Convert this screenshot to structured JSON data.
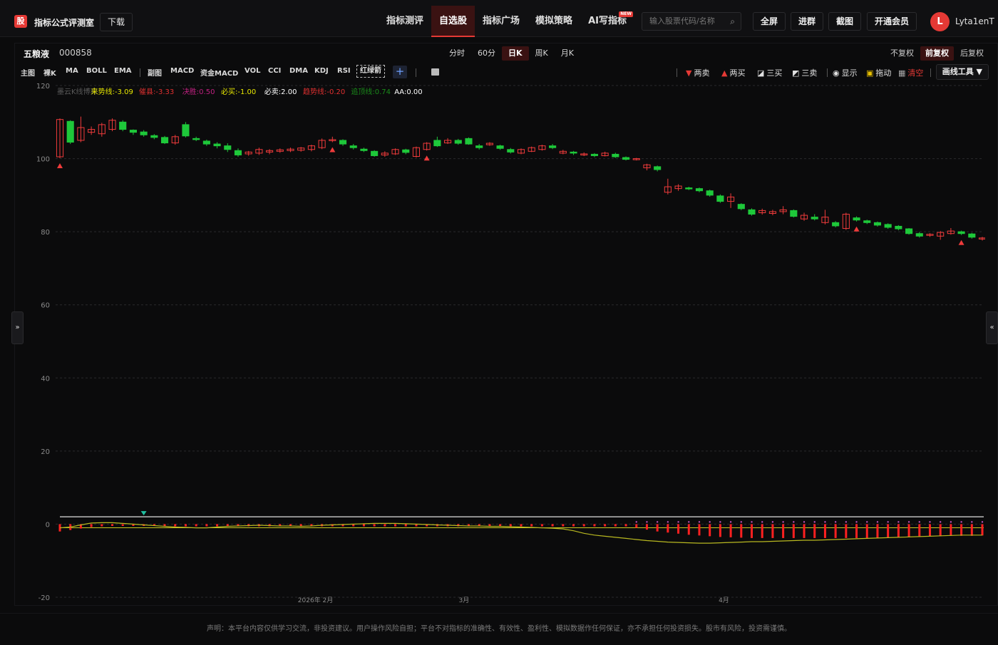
{
  "header": {
    "logo_char": "股",
    "site_title": "指标公式评测室",
    "download": "下载",
    "nav": [
      {
        "label": "指标测评",
        "active": false
      },
      {
        "label": "自选股",
        "active": true
      },
      {
        "label": "指标广场",
        "active": false
      },
      {
        "label": "模拟策略",
        "active": false
      },
      {
        "label": "AI写指标",
        "active": false,
        "badge": "NEW"
      }
    ],
    "search_placeholder": "输入股票代码/名称",
    "buttons": [
      "全屏",
      "进群",
      "截图",
      "开通会员"
    ],
    "avatar_letter": "L",
    "username": "Lyta1enT"
  },
  "stock": {
    "name": "五粮液",
    "code": "000858"
  },
  "periods": [
    {
      "label": "分时",
      "active": false
    },
    {
      "label": "60分",
      "active": false
    },
    {
      "label": "日K",
      "active": true
    },
    {
      "label": "周K",
      "active": false
    },
    {
      "label": "月K",
      "active": false
    }
  ],
  "adjust": [
    {
      "label": "不复权",
      "active": false
    },
    {
      "label": "前复权",
      "active": true
    },
    {
      "label": "后复权",
      "active": false
    }
  ],
  "indicators": {
    "main_label": "主图",
    "main": [
      "裸K",
      "MA",
      "BOLL",
      "EMA"
    ],
    "sub_label": "副图",
    "sub": [
      "MACD",
      "资金MACD",
      "VOL",
      "CCI",
      "DMA",
      "KDJ",
      "RSI"
    ],
    "custom": "红绿箭",
    "add": "+"
  },
  "tools": {
    "two_sell": "两卖",
    "two_buy": "两买",
    "three_buy": "三买",
    "three_sell": "三卖",
    "show": "显示",
    "drag": "拖动",
    "clear": "清空",
    "draw_tool": "画线工具 ▼"
  },
  "legend": [
    {
      "text": "墨云K线博弈",
      "color": "#5a5a5a"
    },
    {
      "text": "来势线:-3.09",
      "color": "#e8e800"
    },
    {
      "text": "催县:-3.33",
      "color": "#e03030"
    },
    {
      "text": "决胜:0.50",
      "color": "#c02080"
    },
    {
      "text": "必买:-1.00",
      "color": "#e8e800"
    },
    {
      "text": "必卖:2.00",
      "color": "#ffffff"
    },
    {
      "text": "趋势线:-0.20",
      "color": "#e03030"
    },
    {
      "text": "追顶线:0.74",
      "color": "#1a8a1a"
    },
    {
      "text": "AA:0.00",
      "color": "#ffffff"
    }
  ],
  "side_left": "»",
  "side_right": "«",
  "footer": "声明：本平台内容仅供学习交流，非投资建议。用户操作风险自担；平台不对指标的准确性、有效性、盈利性、模拟数据作任何保证，亦不承担任何投资损失。股市有风险，投资需谨慎。",
  "chart_data": {
    "type": "candlestick",
    "ylim": [
      -20,
      120
    ],
    "yticks": [
      120,
      100,
      80,
      60,
      40,
      20,
      0,
      -20
    ],
    "xlabels": [
      "2026年 2月",
      "3月",
      "4月"
    ],
    "candles": [
      [
        100.5,
        110.7,
        100.1,
        111.0
      ],
      [
        110.2,
        104.5,
        104.0,
        110.5
      ],
      [
        105.0,
        108.5,
        104.5,
        111.5
      ],
      [
        107.2,
        108.0,
        106.5,
        108.8
      ],
      [
        106.8,
        109.3,
        106.0,
        109.8
      ],
      [
        108.0,
        110.5,
        107.5,
        111.0
      ],
      [
        110.0,
        108.0,
        107.5,
        110.5
      ],
      [
        107.8,
        107.2,
        106.5,
        108.0
      ],
      [
        107.3,
        106.5,
        106.0,
        107.8
      ],
      [
        106.3,
        105.8,
        105.3,
        106.7
      ],
      [
        105.8,
        104.3,
        104.0,
        106.2
      ],
      [
        104.3,
        106.0,
        103.8,
        106.5
      ],
      [
        109.3,
        106.2,
        105.8,
        110.0
      ],
      [
        105.5,
        105.3,
        104.8,
        106.0
      ],
      [
        104.8,
        104.0,
        103.5,
        105.2
      ],
      [
        104.0,
        103.5,
        102.8,
        104.5
      ],
      [
        103.5,
        102.5,
        101.8,
        104.2
      ],
      [
        102.2,
        101.0,
        100.5,
        102.8
      ],
      [
        101.3,
        101.8,
        100.8,
        102.1
      ],
      [
        101.5,
        102.5,
        101.0,
        103.0
      ],
      [
        101.8,
        102.2,
        101.2,
        102.6
      ],
      [
        102.0,
        102.4,
        101.6,
        102.8
      ],
      [
        102.2,
        102.6,
        101.8,
        103.0
      ],
      [
        102.3,
        102.9,
        101.9,
        103.2
      ],
      [
        102.5,
        103.5,
        102.0,
        103.8
      ],
      [
        103.0,
        105.0,
        102.6,
        105.5
      ],
      [
        105.0,
        105.2,
        104.5,
        106.0
      ],
      [
        105.0,
        104.0,
        103.5,
        105.3
      ],
      [
        103.5,
        103.0,
        102.5,
        104.0
      ],
      [
        102.6,
        102.2,
        101.8,
        103.0
      ],
      [
        102.0,
        100.8,
        100.5,
        102.3
      ],
      [
        101.0,
        101.5,
        100.5,
        102.0
      ],
      [
        101.3,
        102.5,
        101.0,
        102.8
      ],
      [
        102.4,
        101.7,
        101.2,
        102.7
      ],
      [
        100.6,
        103.0,
        100.3,
        103.3
      ],
      [
        102.5,
        104.2,
        102.2,
        104.5
      ],
      [
        105.0,
        103.5,
        103.2,
        106.0
      ],
      [
        104.3,
        105.0,
        104.0,
        105.6
      ],
      [
        105.0,
        104.2,
        103.8,
        105.4
      ],
      [
        105.5,
        104.0,
        103.8,
        105.8
      ],
      [
        103.5,
        103.0,
        102.5,
        104.0
      ],
      [
        103.8,
        104.2,
        103.5,
        104.5
      ],
      [
        103.5,
        102.8,
        102.4,
        103.8
      ],
      [
        102.5,
        101.8,
        101.4,
        102.9
      ],
      [
        101.5,
        102.5,
        101.2,
        102.8
      ],
      [
        102.0,
        103.0,
        101.8,
        103.3
      ],
      [
        102.5,
        103.5,
        102.2,
        103.8
      ],
      [
        103.5,
        103.0,
        102.6,
        104.0
      ],
      [
        101.5,
        102.0,
        101.2,
        102.4
      ],
      [
        101.8,
        101.5,
        101.0,
        102.1
      ],
      [
        101.0,
        101.3,
        100.7,
        101.7
      ],
      [
        101.2,
        100.8,
        100.4,
        101.5
      ],
      [
        100.8,
        101.5,
        100.6,
        101.9
      ],
      [
        101.2,
        100.5,
        100.2,
        101.6
      ],
      [
        100.3,
        99.8,
        99.5,
        100.6
      ],
      [
        100.0,
        100.0,
        99.5,
        100.2
      ],
      [
        97.5,
        98.3,
        96.8,
        98.6
      ],
      [
        97.8,
        97.0,
        96.5,
        98.1
      ],
      [
        90.8,
        92.3,
        90.2,
        94.5
      ],
      [
        91.8,
        92.5,
        91.2,
        93.0
      ],
      [
        92.0,
        91.8,
        91.4,
        92.3
      ],
      [
        91.8,
        91.2,
        90.8,
        92.1
      ],
      [
        91.2,
        90.0,
        89.6,
        91.5
      ],
      [
        89.8,
        88.3,
        87.9,
        90.2
      ],
      [
        88.3,
        89.5,
        86.5,
        90.5
      ],
      [
        87.5,
        86.3,
        85.9,
        87.8
      ],
      [
        86.0,
        84.8,
        84.4,
        86.4
      ],
      [
        85.2,
        85.8,
        84.7,
        86.3
      ],
      [
        85.0,
        85.5,
        84.5,
        86.0
      ],
      [
        85.5,
        86.0,
        84.8,
        87.0
      ],
      [
        85.8,
        84.2,
        83.9,
        86.1
      ],
      [
        83.5,
        84.5,
        83.0,
        85.2
      ],
      [
        84.0,
        83.5,
        83.1,
        84.8
      ],
      [
        82.5,
        84.0,
        82.0,
        86.0
      ],
      [
        82.5,
        81.6,
        81.2,
        82.9
      ],
      [
        80.9,
        84.8,
        80.5,
        85.2
      ],
      [
        83.8,
        83.2,
        82.8,
        84.2
      ],
      [
        83.0,
        82.5,
        82.1,
        83.3
      ],
      [
        82.5,
        81.8,
        81.4,
        82.8
      ],
      [
        82.0,
        81.2,
        80.8,
        82.3
      ],
      [
        81.5,
        80.8,
        80.4,
        81.8
      ],
      [
        80.8,
        79.5,
        79.2,
        81.0
      ],
      [
        79.5,
        78.8,
        78.4,
        79.9
      ],
      [
        79.0,
        79.3,
        78.6,
        79.6
      ],
      [
        78.8,
        79.8,
        77.8,
        80.2
      ],
      [
        79.5,
        80.2,
        79.2,
        81.0
      ],
      [
        80.0,
        79.5,
        79.1,
        80.3
      ],
      [
        79.4,
        78.5,
        78.1,
        79.7
      ],
      [
        78.0,
        78.3,
        77.6,
        78.6
      ]
    ],
    "buy_markers": [
      0,
      26,
      35,
      76,
      86
    ],
    "sell_markers": [
      8
    ],
    "sub_series": {
      "yellow": [
        -1.0,
        -0.8,
        -0.2,
        0.3,
        0.4,
        0.4,
        0.2,
        0.0,
        -0.2,
        -0.4,
        -0.6,
        -0.8,
        -0.9,
        -1.0,
        -1.0,
        -0.8,
        -0.6,
        -0.5,
        -0.4,
        -0.3,
        -0.4,
        -0.5,
        -0.5,
        -0.6,
        -0.5,
        -0.3,
        -0.2,
        -0.1,
        0.0,
        0.1,
        0.2,
        0.2,
        0.2,
        0.1,
        0.0,
        -0.1,
        -0.2,
        -0.3,
        -0.4,
        -0.5,
        -0.5,
        -0.6,
        -0.6,
        -0.7,
        -0.8,
        -0.9,
        -1.0,
        -1.1,
        -1.3,
        -1.8,
        -2.5,
        -3.0,
        -3.3,
        -3.6,
        -3.9,
        -4.2,
        -4.5,
        -4.7,
        -4.9,
        -5.0,
        -5.1,
        -5.2,
        -5.2,
        -5.1,
        -5.0,
        -4.9,
        -4.8,
        -4.8,
        -4.7,
        -4.6,
        -4.5,
        -4.4,
        -4.4,
        -4.3,
        -4.2,
        -4.1,
        -4.0,
        -3.9,
        -3.8,
        -3.7,
        -3.6,
        -3.5,
        -3.4,
        -3.3,
        -3.2,
        -3.1,
        -3.0,
        -3.0,
        -3.0
      ],
      "bars": [
        -2.0,
        -1.6,
        -1.2,
        -0.8,
        -0.6,
        -0.5,
        -0.5,
        -0.5,
        -0.5,
        -0.5,
        -0.6,
        -0.6,
        -0.6,
        -0.6,
        -0.6,
        -0.6,
        -0.6,
        -0.6,
        -0.6,
        -0.6,
        -0.6,
        -0.6,
        -0.6,
        -0.6,
        -0.6,
        -0.6,
        -0.6,
        -0.6,
        -0.6,
        -0.6,
        -0.6,
        -0.6,
        -0.6,
        -0.6,
        -0.6,
        -0.6,
        -0.6,
        -0.6,
        -0.6,
        -0.6,
        -0.6,
        -0.6,
        -0.6,
        -0.6,
        -0.6,
        -0.6,
        -0.6,
        -0.6,
        -0.6,
        -0.6,
        -0.6,
        -0.6,
        -0.6,
        -0.6,
        -0.6,
        -1.0,
        -1.5,
        -2.0,
        -2.3,
        -2.6,
        -2.9,
        -3.1,
        -3.3,
        -3.5,
        -3.6,
        -3.7,
        -3.8,
        -3.8,
        -3.8,
        -3.8,
        -3.8,
        -3.8,
        -3.8,
        -3.8,
        -3.8,
        -3.8,
        -3.8,
        -3.8,
        -3.8,
        -3.8,
        -3.6,
        -3.5,
        -3.4,
        -3.3,
        -3.3,
        -3.2,
        -3.2,
        -3.2,
        -3.1
      ],
      "ref_high": 2.0,
      "ref_low": -1.0
    }
  }
}
